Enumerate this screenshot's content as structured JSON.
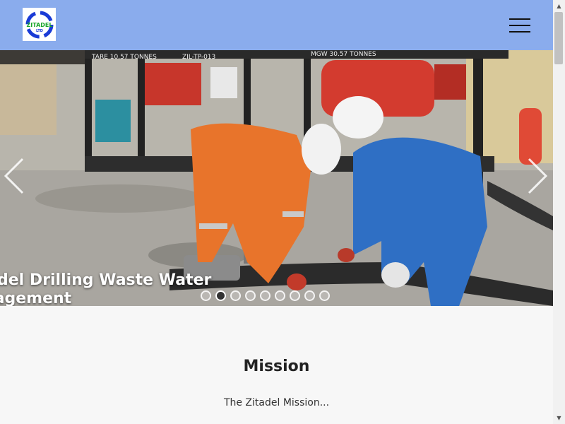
{
  "header": {
    "logo_text": "ZITADEL LTD",
    "menu_icon": "hamburger-menu-icon",
    "background": "#8aaced"
  },
  "slider": {
    "caption_line1": "del Drilling Waste Water",
    "caption_line2": "nagement",
    "signage": {
      "sign_left": "TARE 10.57 TONNES",
      "sign_mid": "ZIL-TP-013",
      "sign_right": "MGW 30.57 TONNES"
    },
    "dot_count": 9,
    "active_dot": 2,
    "prev_icon": "chevron-left-icon",
    "next_icon": "chevron-right-icon"
  },
  "mission": {
    "title": "Mission",
    "text": "The Zitadel Mission..."
  }
}
